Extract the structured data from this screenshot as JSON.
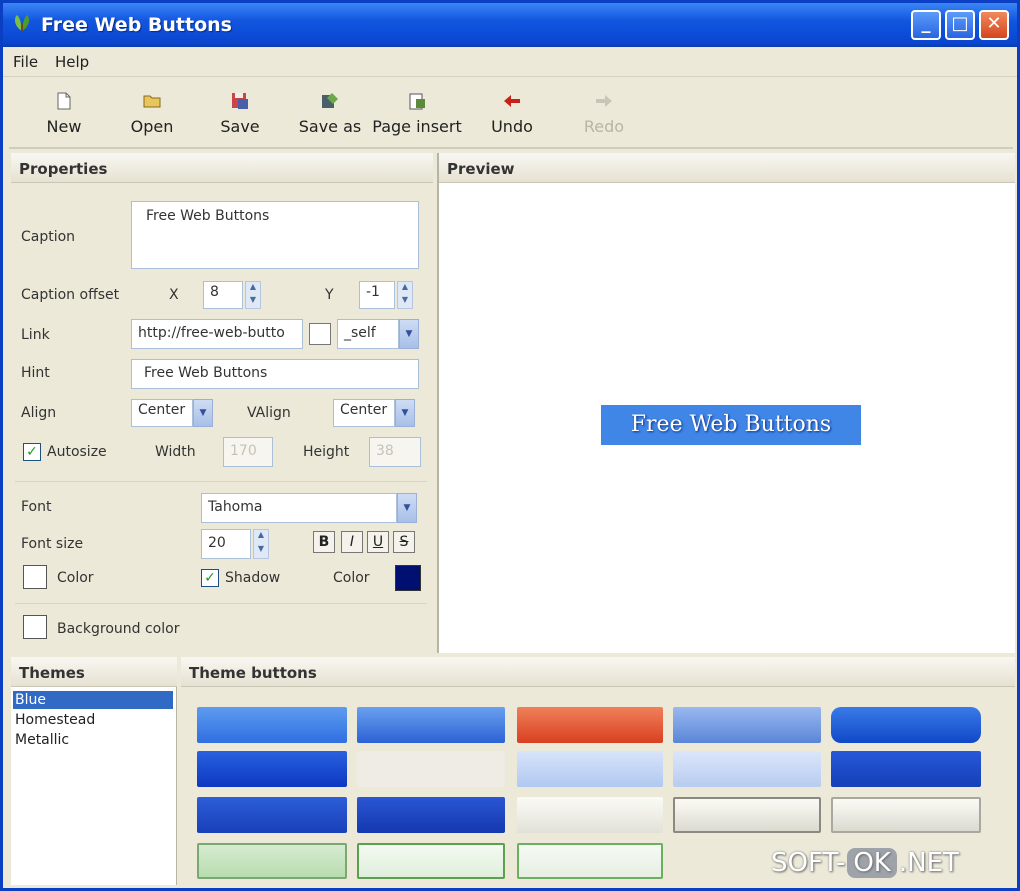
{
  "window": {
    "title": "Free Web Buttons"
  },
  "menu": {
    "items": [
      "File",
      "Help"
    ]
  },
  "toolbar": {
    "new_label": "New",
    "open_label": "Open",
    "save_label": "Save",
    "saveas_label": "Save as",
    "pageinsert_label": "Page insert",
    "undo_label": "Undo",
    "redo_label": "Redo"
  },
  "properties": {
    "header": "Properties",
    "caption_label": "Caption",
    "caption_value": "Free Web Buttons",
    "offset_label": "Caption offset",
    "x_label": "X",
    "x_value": "8",
    "y_label": "Y",
    "y_value": "-1",
    "link_label": "Link",
    "link_value": "http://free-web-butto",
    "target_value": "_self",
    "hint_label": "Hint",
    "hint_value": "Free Web Buttons",
    "align_label": "Align",
    "align_value": "Center",
    "valign_label": "VAlign",
    "valign_value": "Center",
    "autosize_label": "Autosize",
    "width_label": "Width",
    "width_value": "170",
    "height_label": "Height",
    "height_value": "38",
    "font_label": "Font",
    "font_value": "Tahoma",
    "fontsize_label": "Font size",
    "fontsize_value": "20",
    "bold_label": "B",
    "italic_label": "I",
    "underline_label": "U",
    "strike_label": "S",
    "color_label": "Color",
    "shadow_label": "Shadow",
    "shadow_color_label": "Color",
    "shadow_color": "#001070",
    "bgcolor_label": "Background color"
  },
  "preview": {
    "header": "Preview",
    "button_caption": "Free Web Buttons",
    "button_color": "#3f86e6"
  },
  "themes": {
    "header": "Themes",
    "items": [
      "Blue",
      "Homestead",
      "Metallic"
    ],
    "selected": "Blue"
  },
  "theme_buttons": {
    "header": "Theme buttons"
  },
  "watermark": {
    "left": "SOFT-",
    "ok": "OK",
    "right": ".NET"
  }
}
